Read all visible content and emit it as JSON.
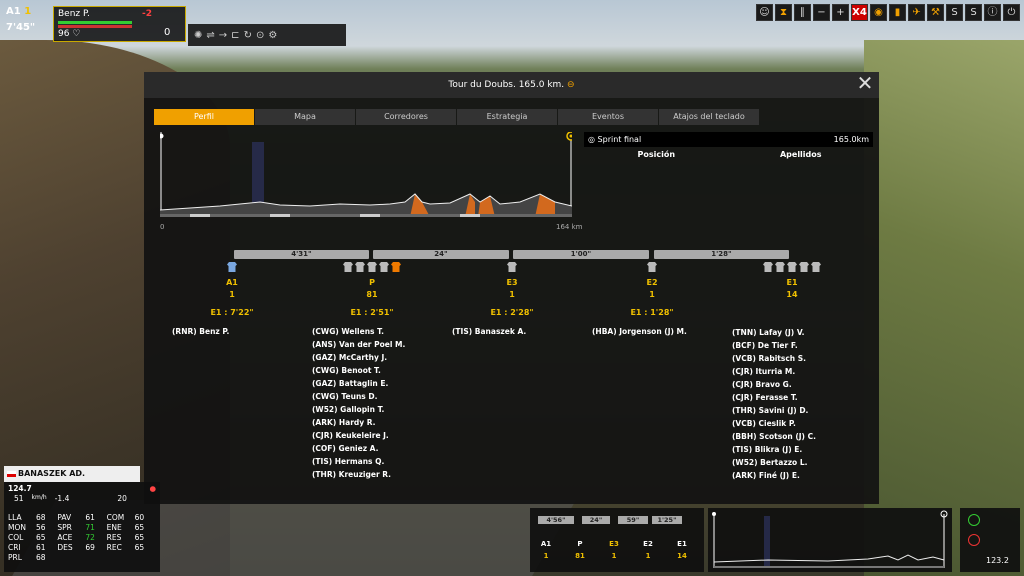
{
  "hud": {
    "position": "A1",
    "count": "1",
    "time": "7'45\"",
    "rider_name": "Benz P.",
    "rider_gap": "-2",
    "energy": "96",
    "zero": "0"
  },
  "toolbar_right": [
    "person-icon",
    "hourglass-icon",
    "pause-icon",
    "minus-icon",
    "plus-icon",
    "X4",
    "eye-icon",
    "bottle-icon",
    "plane-icon",
    "wrench-icon",
    "S",
    "S",
    "info-icon",
    "power-icon"
  ],
  "panel": {
    "title": "Tour du Doubs. 165.0 km.",
    "tabs": [
      "Perfil",
      "Mapa",
      "Corredores",
      "Estrategia",
      "Eventos",
      "Atajos del teclado"
    ],
    "active_tab": 0,
    "km_start": "0",
    "km_end": "164 km",
    "sprint": {
      "label": "Sprint final",
      "distance": "165.0km",
      "col_position": "Posición",
      "col_name": "Apellidos"
    },
    "gaps": [
      "4'31\"",
      "24\"",
      "1'00\"",
      "1'28\""
    ],
    "groups": [
      {
        "code": "A1",
        "count": "1",
        "time": "E1 : 7'22\"",
        "jerseys": [
          "blue"
        ],
        "riders": [
          "(RNR) Benz P."
        ]
      },
      {
        "code": "P",
        "count": "81",
        "time": "E1 : 2'51\"",
        "jerseys": [
          "grey",
          "grey",
          "grey",
          "grey",
          "orange"
        ],
        "riders": [
          "(CWG) Wellens T.",
          "(ANS) Van der Poel M.",
          "(GAZ) McCarthy J.",
          "(CWG) Benoot T.",
          "(GAZ) Battaglin E.",
          "(CWG) Teuns D.",
          "(W52) Gallopin T.",
          "(ARK) Hardy R.",
          "(CJR) Keukeleire J.",
          "(COF) Geniez A.",
          "(TIS) Hermans Q.",
          "(THR) Kreuziger R."
        ]
      },
      {
        "code": "E3",
        "count": "1",
        "time": "E1 : 2'28\"",
        "jerseys": [
          "grey"
        ],
        "riders": [
          "(TIS) Banaszek A."
        ]
      },
      {
        "code": "E2",
        "count": "1",
        "time": "E1 : 1'28\"",
        "jerseys": [
          "grey"
        ],
        "riders": [
          "(HBA) Jorgenson (J) M."
        ]
      },
      {
        "code": "E1",
        "count": "14",
        "time": "",
        "jerseys": [
          "grey",
          "grey",
          "grey",
          "grey",
          "grey"
        ],
        "riders": [
          "(TNN) Lafay (J) V.",
          "(BCF) De Tier F.",
          "(VCB) Rabitsch S.",
          "(CJR) Iturria M.",
          "(CJR) Bravo G.",
          "(CJR) Ferasse T.",
          "(THR) Savini (J) D.",
          "(VCB) Cieslik P.",
          "(BBH) Scotson (J) C.",
          "(TIS) Blikra (J) E.",
          "(W52) Bertazzo L.",
          "(ARK) Finé (J) E."
        ]
      }
    ]
  },
  "bottom_left": {
    "name": "BANASZEK AD.",
    "speed": "124.7",
    "hr": "51",
    "hr_unit": "km/h",
    "grad": "-1.4",
    "twenty": "20",
    "stats": [
      [
        "LLA",
        "68"
      ],
      [
        "PAV",
        "61"
      ],
      [
        "COM",
        "60"
      ],
      [
        "MON",
        "56"
      ],
      [
        "SPR",
        "71"
      ],
      [
        "ENE",
        "65"
      ],
      [
        "COL",
        "65"
      ],
      [
        "ACE",
        "72"
      ],
      [
        "RES",
        "65"
      ],
      [
        "CRI",
        "61"
      ],
      [
        "DES",
        "69"
      ],
      [
        "REC",
        "65"
      ],
      [
        "PRL",
        "68"
      ]
    ]
  },
  "mini": {
    "gaps": [
      "4'56\"",
      "24\"",
      "59\"",
      "1'25\""
    ],
    "cols": [
      [
        "A1",
        "1"
      ],
      [
        "P",
        "81"
      ],
      [
        "E3",
        "1"
      ],
      [
        "E2",
        "1"
      ],
      [
        "E1",
        "14"
      ]
    ]
  },
  "bottom_right": {
    "value": "123.2"
  }
}
